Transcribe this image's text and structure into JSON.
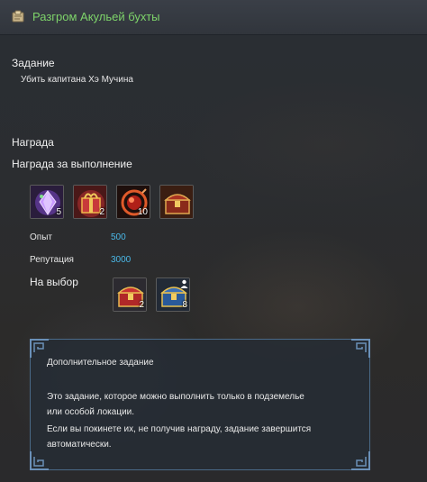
{
  "header": {
    "title": "Разгром Акульей бухты"
  },
  "task": {
    "heading": "Задание",
    "description": "Убить капитана Хэ Мучина"
  },
  "reward": {
    "heading": "Награда",
    "completion_heading": "Награда за выполнение",
    "items": [
      {
        "icon": "purple-crystal-icon",
        "count": "5"
      },
      {
        "icon": "red-gift-box-icon",
        "count": "2"
      },
      {
        "icon": "red-orb-icon",
        "count": "10"
      },
      {
        "icon": "treasure-chest-icon",
        "count": ""
      }
    ],
    "experience_label": "Опыт",
    "experience_value": "500",
    "reputation_label": "Репутация",
    "reputation_value": "3000",
    "choice_label": "На выбор",
    "choice_items": [
      {
        "icon": "red-chest-icon",
        "count": "2"
      },
      {
        "icon": "blue-chest-icon",
        "count": "8"
      }
    ]
  },
  "info": {
    "title": "Дополнительное задание",
    "lines": [
      "Это задание, которое можно выполнить только в подземелье",
      "или особой локации.",
      "Если вы покинете их, не получив награду, задание завершится",
      "автоматически."
    ]
  },
  "colors": {
    "title_green": "#7ed46a",
    "value_blue": "#4ab8e8",
    "frame_blue": "#4a6a88"
  }
}
